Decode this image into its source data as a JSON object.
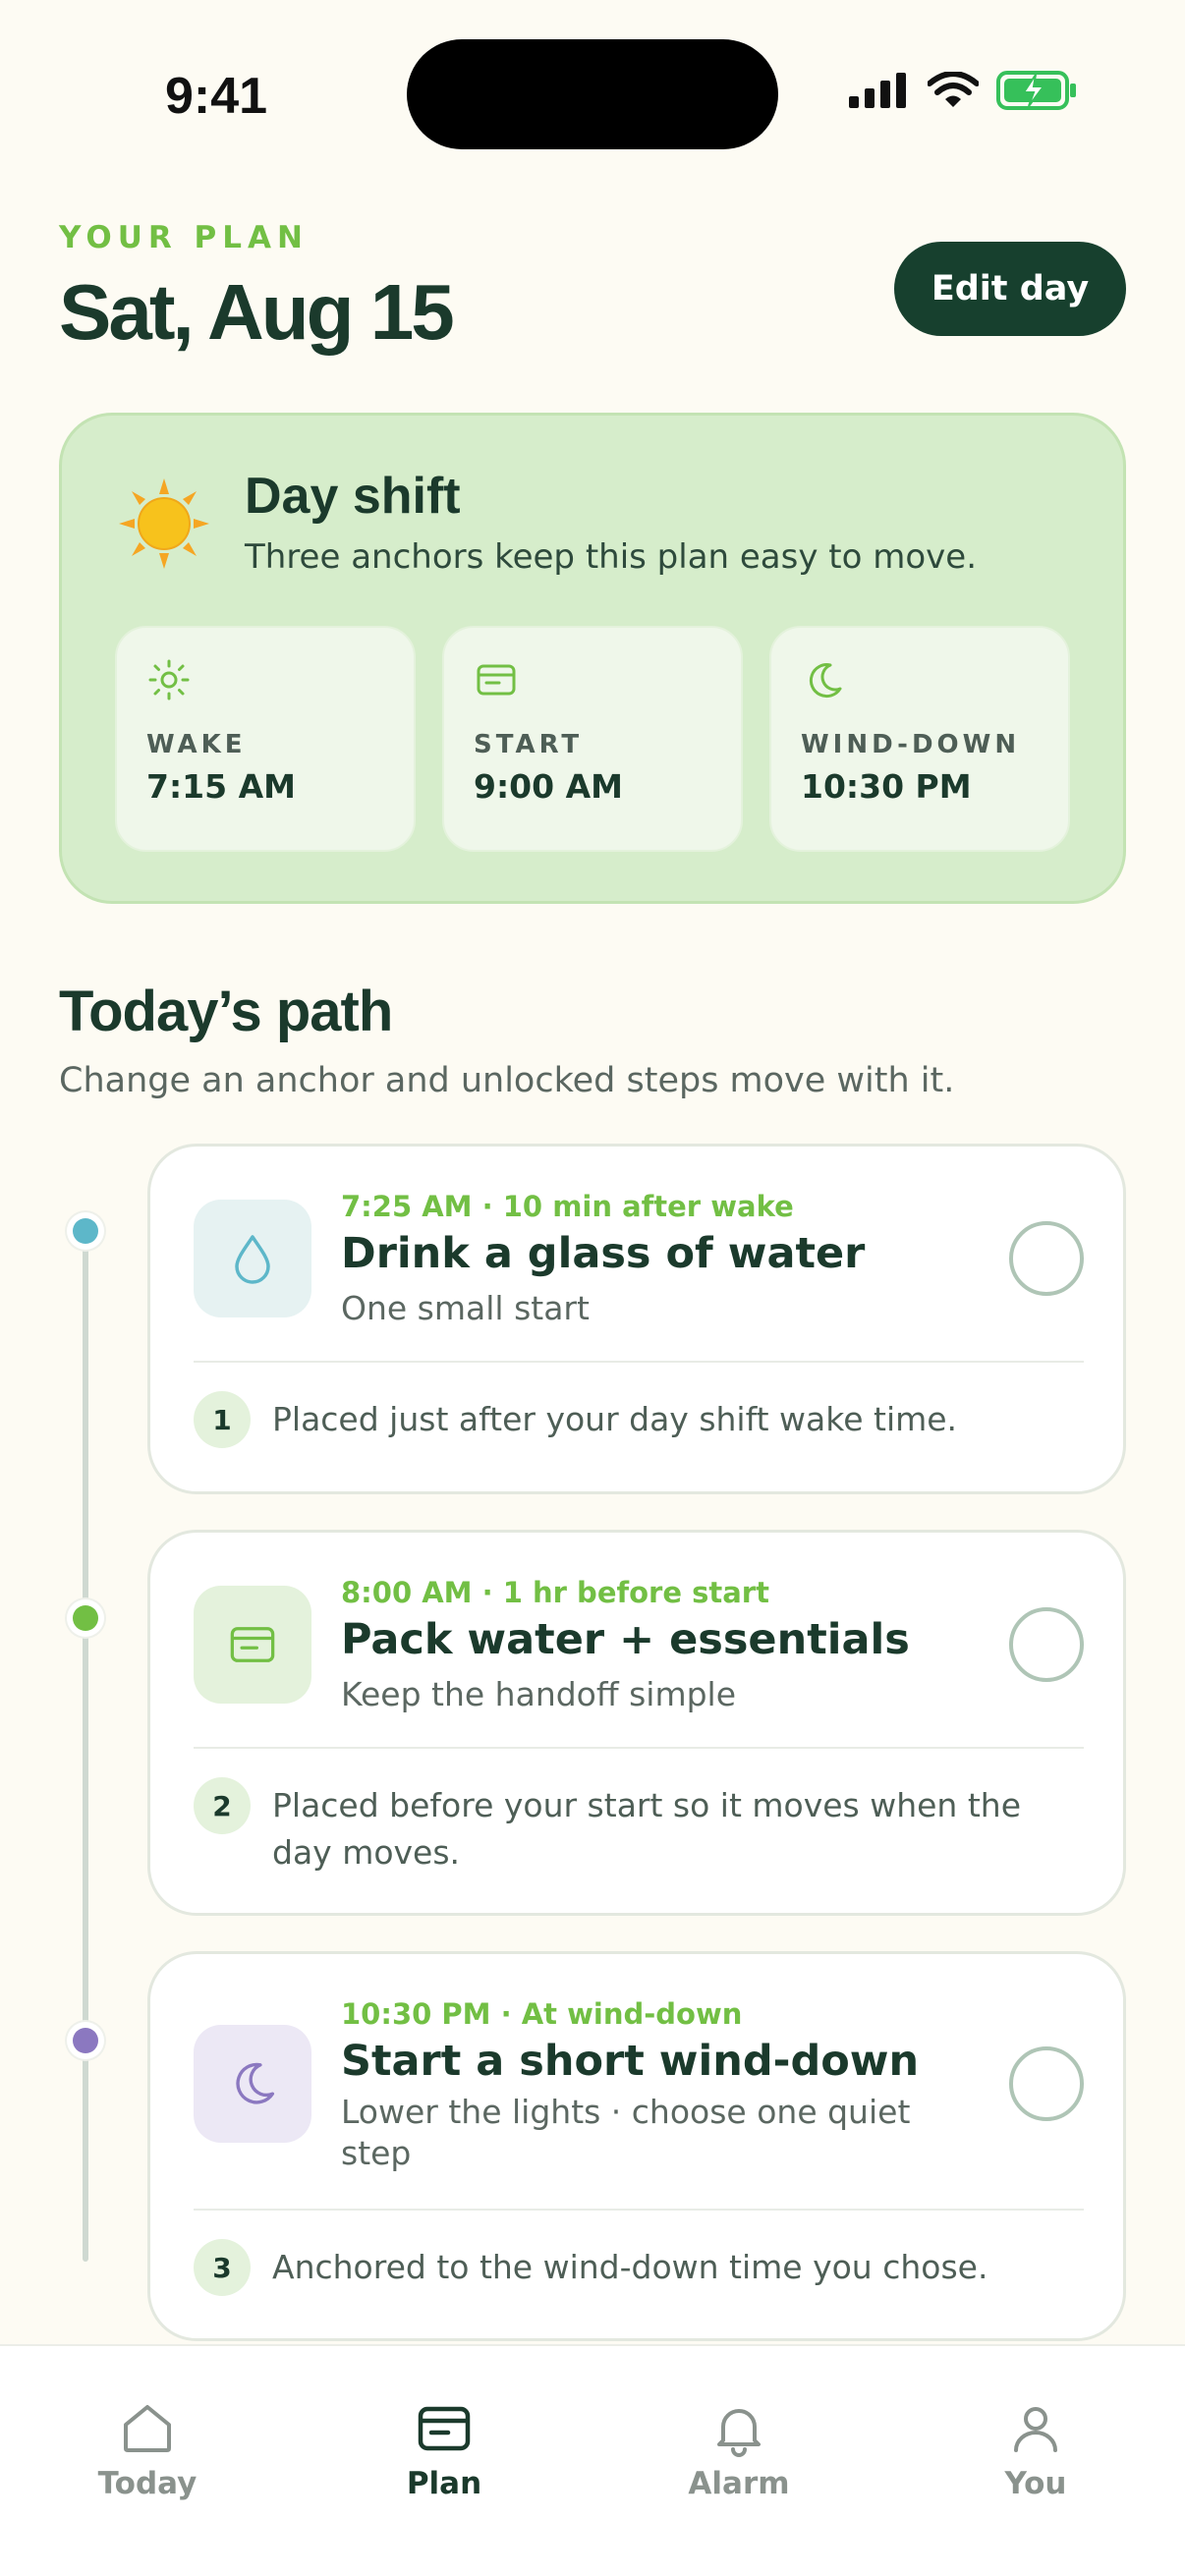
{
  "status_bar": {
    "time": "9:41"
  },
  "header": {
    "eyebrow": "YOUR PLAN",
    "title": "Sat, Aug 15",
    "edit_label": "Edit day"
  },
  "shift": {
    "title": "Day shift",
    "subtitle": "Three anchors keep this plan easy to move.",
    "anchors": [
      {
        "label": "WAKE",
        "value": "7:15 AM",
        "icon": "sun-icon"
      },
      {
        "label": "START",
        "value": "9:00 AM",
        "icon": "card-icon"
      },
      {
        "label": "WIND-DOWN",
        "value": "10:30 PM",
        "icon": "moon-icon"
      }
    ]
  },
  "path": {
    "title": "Today’s path",
    "subtitle": "Change an anchor and unlocked steps move with it.",
    "steps": [
      {
        "meta": "7:25 AM · 10 min after wake",
        "title": "Drink a glass of water",
        "desc": "One small start",
        "num": "1",
        "note": "Placed just after your day shift wake time.",
        "icon": "water-drop-icon",
        "dot_color": "#5DB7C9"
      },
      {
        "meta": "8:00 AM · 1 hr before start",
        "title": "Pack water + essentials",
        "desc": "Keep the handoff simple",
        "num": "2",
        "note": "Placed before your start so it moves when the day moves.",
        "icon": "card-icon",
        "dot_color": "#72BF44"
      },
      {
        "meta": "10:30 PM · At wind-down",
        "title": "Start a short wind-down",
        "desc": "Lower the lights · choose one quiet step",
        "num": "3",
        "note": "Anchored to the wind-down time you chose.",
        "icon": "moon-icon",
        "dot_color": "#8B78C0"
      }
    ]
  },
  "tabs": [
    {
      "label": "Today",
      "icon": "home-icon",
      "active": false
    },
    {
      "label": "Plan",
      "icon": "card-icon",
      "active": true
    },
    {
      "label": "Alarm",
      "icon": "bell-icon",
      "active": false
    },
    {
      "label": "You",
      "icon": "person-icon",
      "active": false
    }
  ],
  "colors": {
    "accent": "#72BF44",
    "primary": "#17402E",
    "background": "#FDFBF3",
    "shift_card": "#D6EDCB"
  }
}
